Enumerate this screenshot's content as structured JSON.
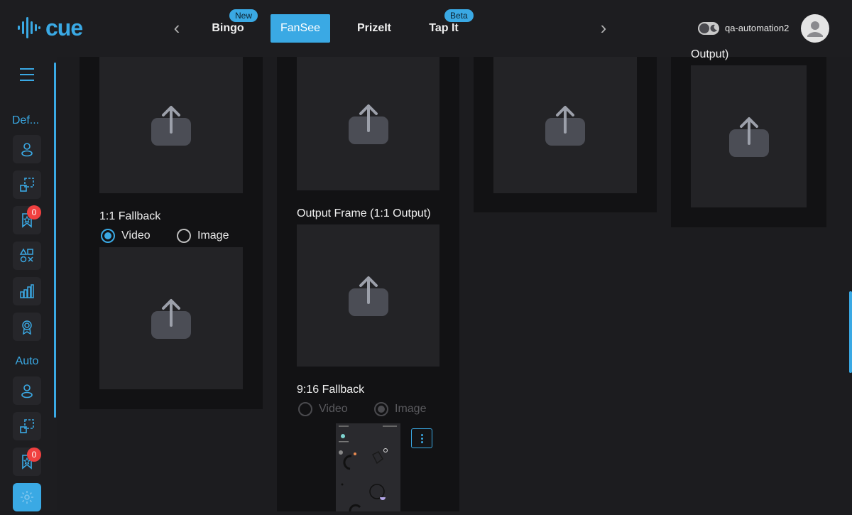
{
  "app": {
    "logo_text": "cue",
    "username": "qa-automation2"
  },
  "nav": {
    "tabs": [
      {
        "label": "Bingo",
        "tag": "New"
      },
      {
        "label": "FanSee",
        "tag": ""
      },
      {
        "label": "PrizeIt",
        "tag": ""
      },
      {
        "label": "Tap It",
        "tag": "Beta"
      }
    ],
    "active_tab": "FanSee"
  },
  "sidebar": {
    "sections": [
      {
        "label": "Def...",
        "items": [
          "user-icon",
          "layout-icon",
          "badge-icon",
          "shapes-icon",
          "bar-chart-icon",
          "award-icon"
        ],
        "badge_count": "0"
      },
      {
        "label": "Auto",
        "items": [
          "user-icon",
          "layout-icon",
          "badge-icon",
          "gear-icon"
        ],
        "badge_count": "0"
      }
    ]
  },
  "main": {
    "col1": {
      "fallback_label": "1:1 Fallback",
      "radio": {
        "video": "Video",
        "image": "Image",
        "selected": "Video"
      }
    },
    "col2": {
      "output_frame_label": "Output Frame (1:1 Output)",
      "fallback_label": "9:16 Fallback",
      "radio": {
        "video": "Video",
        "image": "Image",
        "selected": "Image",
        "disabled": true
      }
    },
    "col4": {
      "partial_label": "Output)"
    }
  },
  "colors": {
    "accent": "#3aa9e4",
    "panel": "#121214",
    "dropzone": "#232326",
    "notification": "#f04040"
  }
}
